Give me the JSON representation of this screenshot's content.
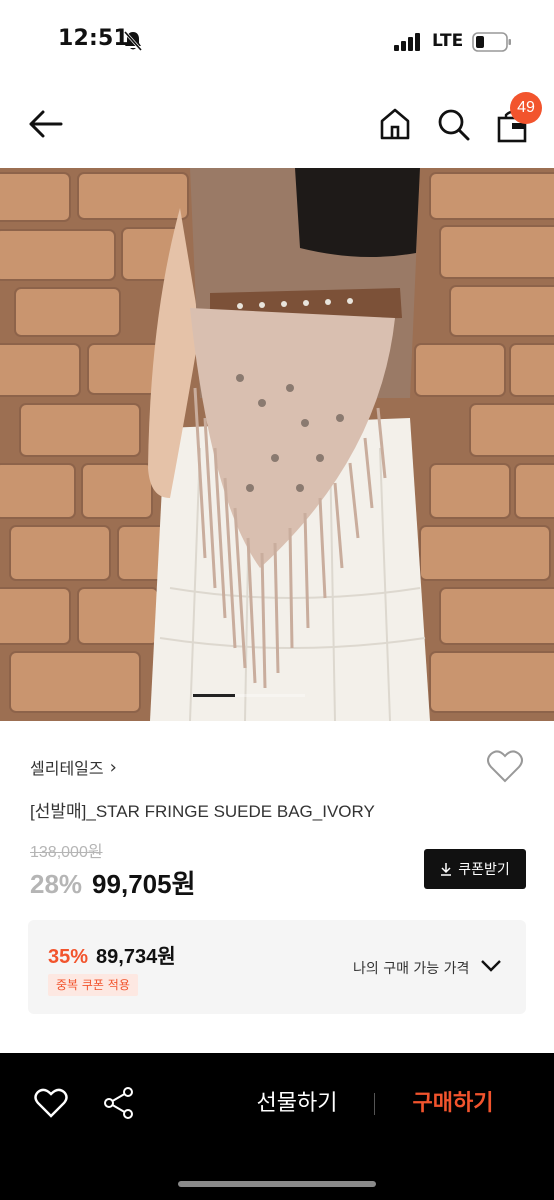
{
  "status_bar": {
    "time": "12:51",
    "network": "LTE",
    "icons": [
      "bell-slash-icon",
      "signal-icon",
      "battery-icon"
    ]
  },
  "header": {
    "icons": [
      "back-arrow-icon",
      "home-icon",
      "search-icon",
      "shopping-bag-icon"
    ],
    "cart_count": "49"
  },
  "product": {
    "carousel_position": 1,
    "brand": "셀리테일즈",
    "title": "[선발매]_STAR FRINGE SUEDE BAG_IVORY",
    "original_price": "138,000원",
    "discount_rate": "28%",
    "sale_price": "99,705원",
    "coupon_button_label": "쿠폰받기"
  },
  "best_price": {
    "rate": "35%",
    "price": "89,734원",
    "coupon_tag": "중복 쿠폰 적용",
    "my_price_label": "나의 구매 가능 가격"
  },
  "bottom_bar": {
    "gift_label": "선물하기",
    "buy_label": "구매하기"
  },
  "colors": {
    "accent": "#f2542d",
    "dark": "#111111",
    "muted": "#b5b5b5"
  }
}
